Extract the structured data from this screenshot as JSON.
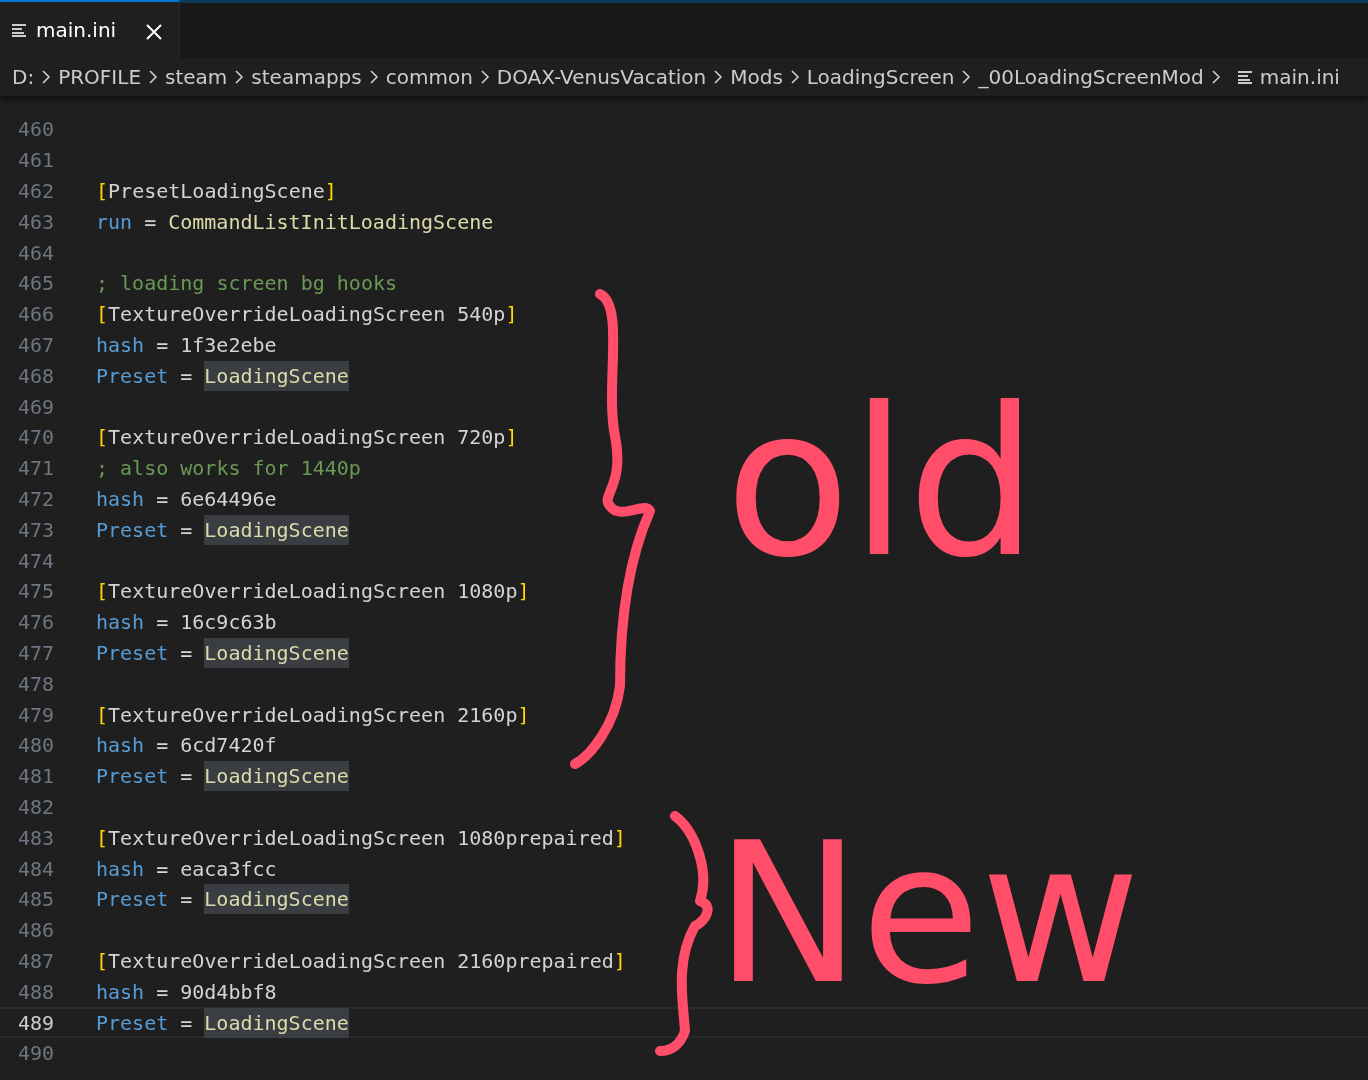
{
  "tabs": [
    {
      "label": "main.ini",
      "selected": true
    }
  ],
  "breadcrumb": [
    "D:",
    "PROFILE",
    "steam",
    "steamapps",
    "common",
    "DOAX-VenusVacation",
    "Mods",
    "LoadingScreen",
    "_00LoadingScreenMod",
    "main.ini"
  ],
  "lines": [
    {
      "number": "460",
      "kind": "blank",
      "current": false
    },
    {
      "number": "461",
      "kind": "blank",
      "current": false
    },
    {
      "number": "462",
      "kind": "section",
      "open": "[",
      "name": "PresetLoadingScene",
      "close": "]",
      "current": false
    },
    {
      "number": "463",
      "kind": "pair",
      "key": "run",
      "op": "=",
      "value": "CommandListInitLoadingScene",
      "highlighted": false,
      "current": false
    },
    {
      "number": "464",
      "kind": "blank",
      "current": false
    },
    {
      "number": "465",
      "kind": "comment",
      "text": "; loading screen bg hooks",
      "current": false
    },
    {
      "number": "466",
      "kind": "section",
      "open": "[",
      "name": "TextureOverrideLoadingScreen 540p",
      "close": "]",
      "current": false
    },
    {
      "number": "467",
      "kind": "hexpair",
      "key": "hash",
      "op": "=",
      "value": "1f3e2ebe",
      "highlighted": false,
      "current": false
    },
    {
      "number": "468",
      "kind": "pair",
      "key": "Preset",
      "op": "=",
      "value": "LoadingScene",
      "highlighted": true,
      "current": false
    },
    {
      "number": "469",
      "kind": "blank",
      "current": false
    },
    {
      "number": "470",
      "kind": "section",
      "open": "[",
      "name": "TextureOverrideLoadingScreen 720p",
      "close": "]",
      "current": false
    },
    {
      "number": "471",
      "kind": "comment",
      "text": "; also works for 1440p",
      "current": false
    },
    {
      "number": "472",
      "kind": "hexpair",
      "key": "hash",
      "op": "=",
      "value": "6e64496e",
      "highlighted": false,
      "current": false
    },
    {
      "number": "473",
      "kind": "pair",
      "key": "Preset",
      "op": "=",
      "value": "LoadingScene",
      "highlighted": true,
      "current": false
    },
    {
      "number": "474",
      "kind": "blank",
      "current": false
    },
    {
      "number": "475",
      "kind": "section",
      "open": "[",
      "name": "TextureOverrideLoadingScreen 1080p",
      "close": "]",
      "current": false
    },
    {
      "number": "476",
      "kind": "hexpair",
      "key": "hash",
      "op": "=",
      "value": "16c9c63b",
      "highlighted": false,
      "current": false
    },
    {
      "number": "477",
      "kind": "pair",
      "key": "Preset",
      "op": "=",
      "value": "LoadingScene",
      "highlighted": true,
      "current": false
    },
    {
      "number": "478",
      "kind": "blank",
      "current": false
    },
    {
      "number": "479",
      "kind": "section",
      "open": "[",
      "name": "TextureOverrideLoadingScreen 2160p",
      "close": "]",
      "current": false
    },
    {
      "number": "480",
      "kind": "hexpair",
      "key": "hash",
      "op": "=",
      "value": "6cd7420f",
      "highlighted": false,
      "current": false
    },
    {
      "number": "481",
      "kind": "pair",
      "key": "Preset",
      "op": "=",
      "value": "LoadingScene",
      "highlighted": true,
      "current": false
    },
    {
      "number": "482",
      "kind": "blank",
      "current": false
    },
    {
      "number": "483",
      "kind": "section",
      "open": "[",
      "name": "TextureOverrideLoadingScreen 1080prepaired",
      "close": "]",
      "current": false
    },
    {
      "number": "484",
      "kind": "hexpair",
      "key": "hash",
      "op": "=",
      "value": "eaca3fcc",
      "highlighted": false,
      "current": false
    },
    {
      "number": "485",
      "kind": "pair",
      "key": "Preset",
      "op": "=",
      "value": "LoadingScene",
      "highlighted": true,
      "current": false
    },
    {
      "number": "486",
      "kind": "blank",
      "current": false
    },
    {
      "number": "487",
      "kind": "section",
      "open": "[",
      "name": "TextureOverrideLoadingScreen 2160prepaired",
      "close": "]",
      "current": false
    },
    {
      "number": "488",
      "kind": "hexpair",
      "key": "hash",
      "op": "=",
      "value": "90d4bbf8",
      "highlighted": false,
      "current": false
    },
    {
      "number": "489",
      "kind": "pair",
      "key": "Preset",
      "op": "=",
      "value": "LoadingScene",
      "highlighted": true,
      "current": true
    },
    {
      "number": "490",
      "kind": "blank",
      "current": false
    }
  ],
  "annotations": [
    {
      "text": "old",
      "kind": "brace-label"
    },
    {
      "text": "New",
      "kind": "brace-label"
    }
  ]
}
